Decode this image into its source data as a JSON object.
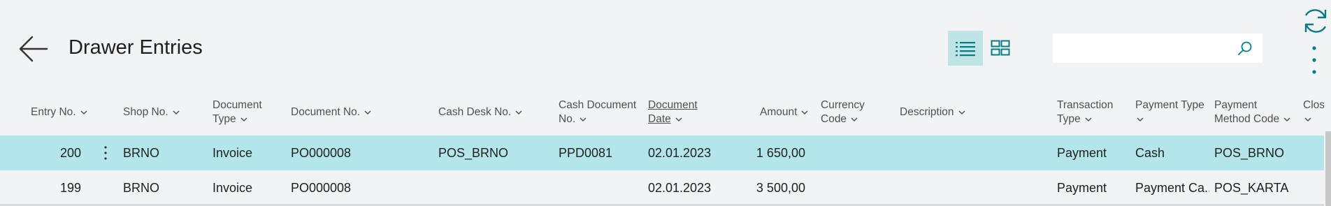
{
  "page": {
    "title": "Drawer Entries"
  },
  "icons": {
    "back": "arrow-left-icon",
    "list_view": "list-view-icon",
    "tile_view": "tile-view-icon",
    "search": "search-icon",
    "refresh": "refresh-icon",
    "more": "more-vertical-icon"
  },
  "colors": {
    "accent": "#0a7b83",
    "selected_row": "#b3e6ea",
    "active_view": "#bfe4e6"
  },
  "search": {
    "value": "",
    "placeholder": ""
  },
  "columns": {
    "entry_no": "Entry No.",
    "shop_no": "Shop No.",
    "document_type_1": "Document",
    "document_type_2": "Type",
    "document_no": "Document No.",
    "cash_desk_no": "Cash Desk No.",
    "cash_document_no_1": "Cash Document",
    "cash_document_no_2": "No.",
    "document_date_1": "Document",
    "document_date_2": "Date",
    "amount": "Amount",
    "currency_code_1": "Currency",
    "currency_code_2": "Code",
    "description": "Description",
    "transaction_type_1": "Transaction",
    "transaction_type_2": "Type",
    "payment_type": "Payment Type",
    "payment_method_code_1": "Payment",
    "payment_method_code_2": "Method Code",
    "closing": "Closin"
  },
  "rows": [
    {
      "entry_no": "200",
      "shop_no": "BRNO",
      "document_type": "Invoice",
      "document_no": "PO000008",
      "cash_desk_no": "POS_BRNO",
      "cash_document_no": "PPD0081",
      "document_date": "02.01.2023",
      "amount": "1 650,00",
      "currency_code": "",
      "description": "",
      "transaction_type": "Payment",
      "payment_type": "Cash",
      "payment_method_code": "POS_BRNO"
    },
    {
      "entry_no": "199",
      "shop_no": "BRNO",
      "document_type": "Invoice",
      "document_no": "PO000008",
      "cash_desk_no": "",
      "cash_document_no": "",
      "document_date": "02.01.2023",
      "amount": "3 500,00",
      "currency_code": "",
      "description": "",
      "transaction_type": "Payment",
      "payment_type": "Payment Ca...",
      "payment_method_code": "POS_KARTA"
    }
  ]
}
